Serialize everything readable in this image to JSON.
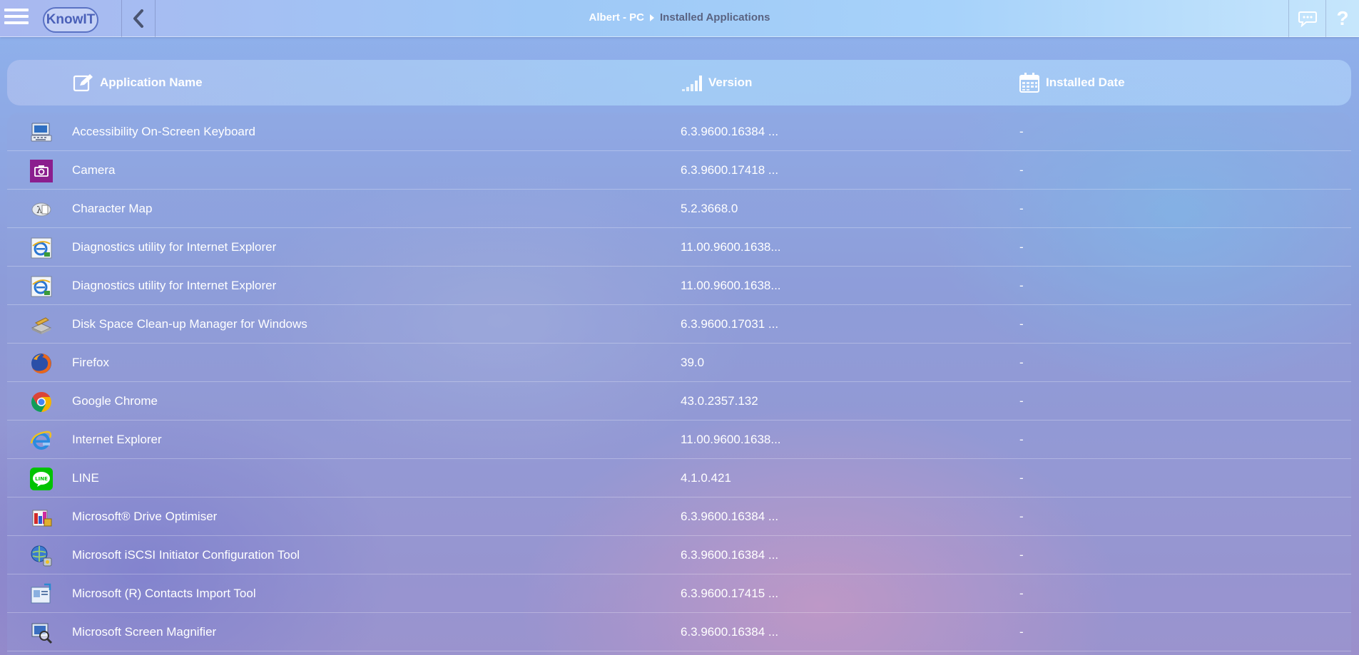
{
  "header": {
    "logo_text": "KnowIT",
    "breadcrumb": {
      "host": "Albert - PC",
      "page": "Installed Applications"
    }
  },
  "columns": {
    "name": "Application Name",
    "version": "Version",
    "installed_date": "Installed Date"
  },
  "apps": [
    {
      "name": "Accessibility On-Screen Keyboard",
      "version": "6.3.9600.16384 ...",
      "date": "-",
      "icon": "keyboard-icon"
    },
    {
      "name": "Camera",
      "version": "6.3.9600.17418 ...",
      "date": "-",
      "icon": "camera-icon"
    },
    {
      "name": "Character Map",
      "version": "5.2.3668.0",
      "date": "-",
      "icon": "character-map-icon"
    },
    {
      "name": "Diagnostics utility for Internet Explorer",
      "version": "11.00.9600.1638...",
      "date": "-",
      "icon": "ie-diagnostics-icon"
    },
    {
      "name": "Diagnostics utility for Internet Explorer",
      "version": "11.00.9600.1638...",
      "date": "-",
      "icon": "ie-diagnostics-icon"
    },
    {
      "name": "Disk Space Clean-up Manager for Windows",
      "version": "6.3.9600.17031 ...",
      "date": "-",
      "icon": "disk-cleanup-icon"
    },
    {
      "name": "Firefox",
      "version": "39.0",
      "date": "-",
      "icon": "firefox-icon"
    },
    {
      "name": "Google Chrome",
      "version": "43.0.2357.132",
      "date": "-",
      "icon": "chrome-icon"
    },
    {
      "name": "Internet Explorer",
      "version": "11.00.9600.1638...",
      "date": "-",
      "icon": "internet-explorer-icon"
    },
    {
      "name": "LINE",
      "version": "4.1.0.421",
      "date": "-",
      "icon": "line-icon"
    },
    {
      "name": "Microsoft® Drive Optimiser",
      "version": "6.3.9600.16384 ...",
      "date": "-",
      "icon": "drive-optimiser-icon"
    },
    {
      "name": "Microsoft iSCSI Initiator Configuration Tool",
      "version": "6.3.9600.16384 ...",
      "date": "-",
      "icon": "iscsi-icon"
    },
    {
      "name": "Microsoft (R) Contacts Import Tool",
      "version": "6.3.9600.17415 ...",
      "date": "-",
      "icon": "contacts-import-icon"
    },
    {
      "name": "Microsoft Screen Magnifier",
      "version": "6.3.9600.16384 ...",
      "date": "-",
      "icon": "magnifier-icon"
    }
  ]
}
